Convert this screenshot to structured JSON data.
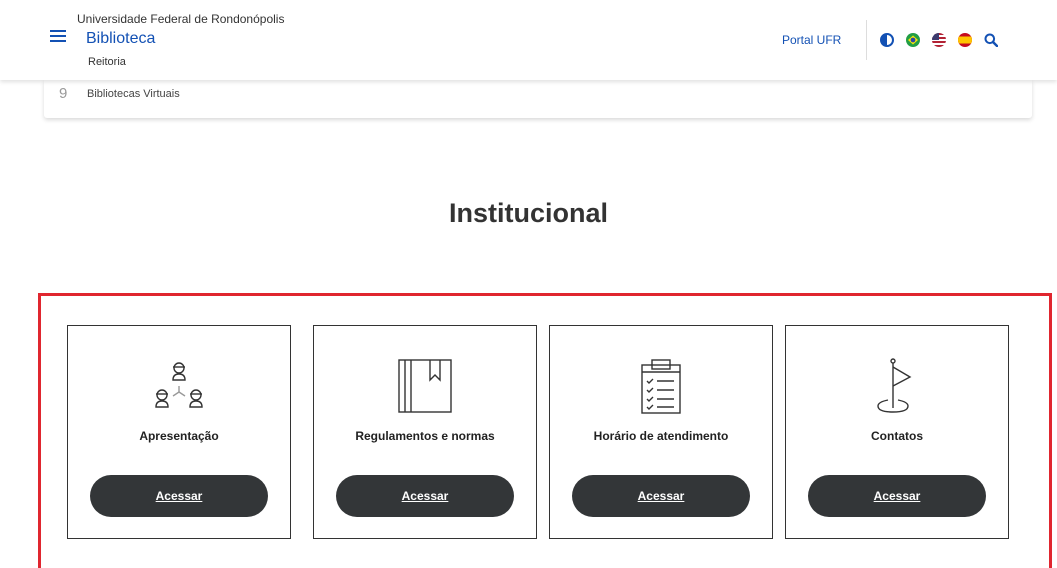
{
  "header": {
    "organization": "Universidade Federal de Rondonópolis",
    "title": "Biblioteca",
    "subtitle": "Reitoria",
    "portal_link": "Portal UFR",
    "icons": [
      "contrast-icon",
      "flag-brazil-icon",
      "flag-us-icon",
      "flag-spain-icon",
      "search-icon"
    ]
  },
  "virtual_libraries": {
    "number": "9",
    "label": "Bibliotecas Virtuais"
  },
  "section": {
    "title": "Institucional"
  },
  "cards": [
    {
      "label": "Apresentação",
      "button": "Acessar",
      "icon": "people-network-icon"
    },
    {
      "label": "Regulamentos e normas",
      "button": "Acessar",
      "icon": "book-icon"
    },
    {
      "label": "Horário de atendimento",
      "button": "Acessar",
      "icon": "clipboard-checklist-icon"
    },
    {
      "label": "Contatos",
      "button": "Acessar",
      "icon": "location-flag-icon"
    }
  ],
  "colors": {
    "brand_blue": "#1351b4",
    "button_dark": "#333638",
    "highlight_red": "#e0262f"
  }
}
